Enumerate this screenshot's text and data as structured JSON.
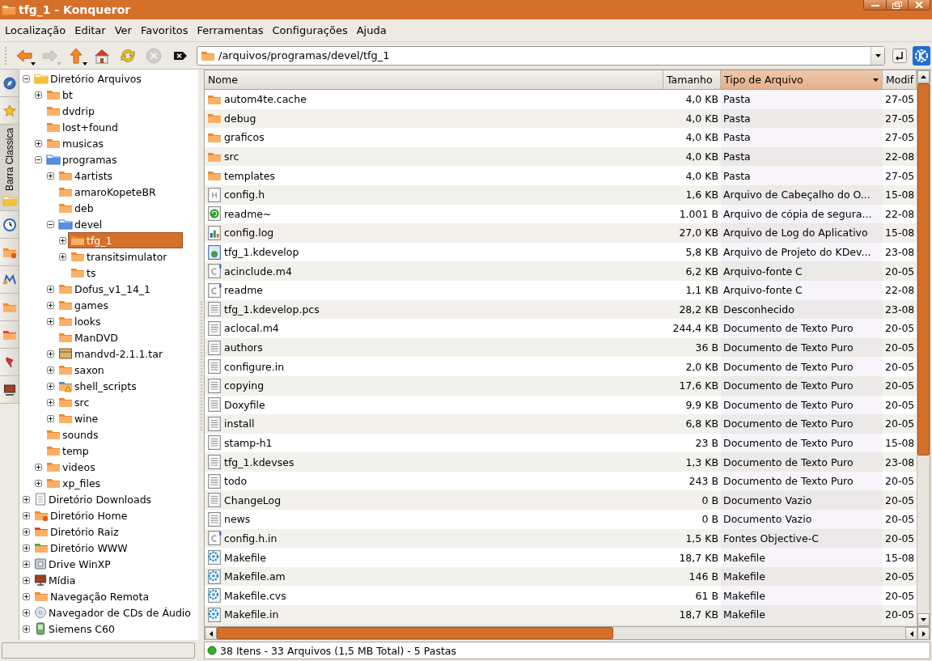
{
  "window": {
    "title": "tfg_1 - Konqueror"
  },
  "menu": [
    "Localização",
    "Editar",
    "Ver",
    "Favoritos",
    "Ferramentas",
    "Configurações",
    "Ajuda"
  ],
  "toolbar": [
    {
      "kind": "back",
      "disabled": false,
      "menu": true
    },
    {
      "kind": "forward",
      "disabled": true,
      "menu": true
    },
    {
      "kind": "up",
      "disabled": false,
      "menu": true
    },
    {
      "kind": "home",
      "disabled": false,
      "menu": false
    },
    {
      "kind": "reload",
      "disabled": false,
      "menu": false
    },
    {
      "kind": "stop",
      "disabled": true,
      "menu": false
    },
    {
      "kind": "clear",
      "disabled": false,
      "menu": false
    }
  ],
  "location": {
    "value": "/arquivos/programas/devel/tfg_1"
  },
  "sidebar_tabs": [
    {
      "kind": "navigation",
      "selected": false
    },
    {
      "kind": "bookmarks",
      "selected": false
    },
    {
      "kind": "folder",
      "selected": true,
      "label": "Barra Classica"
    },
    {
      "kind": "history",
      "selected": false
    },
    {
      "kind": "home",
      "selected": false
    },
    {
      "kind": "media",
      "selected": false
    },
    {
      "kind": "network",
      "selected": false
    },
    {
      "kind": "root",
      "selected": false
    },
    {
      "kind": "services",
      "selected": false
    },
    {
      "kind": "devices",
      "selected": false
    }
  ],
  "tree": [
    {
      "label": "Diretório Arquivos",
      "kind": "yellow-open",
      "expanded": true,
      "selected": false,
      "children": [
        {
          "label": "bt",
          "kind": "folder",
          "expanded": false,
          "selected": false
        },
        {
          "label": "dvdrip",
          "kind": "folder",
          "selected": false
        },
        {
          "label": "lost+found",
          "kind": "folder",
          "selected": false
        },
        {
          "label": "musicas",
          "kind": "folder",
          "expanded": false,
          "selected": false
        },
        {
          "label": "programas",
          "kind": "blue-open",
          "expanded": true,
          "selected": false,
          "children": [
            {
              "label": "4artists",
              "kind": "folder",
              "expanded": false,
              "selected": false
            },
            {
              "label": "amaroKopeteBR",
              "kind": "folder",
              "selected": false
            },
            {
              "label": "deb",
              "kind": "folder",
              "selected": false
            },
            {
              "label": "devel",
              "kind": "blue-open",
              "expanded": true,
              "selected": false,
              "children": [
                {
                  "label": "tfg_1",
                  "kind": "folder",
                  "expanded": false,
                  "selected": true
                },
                {
                  "label": "transitsimulator",
                  "kind": "folder",
                  "expanded": false,
                  "selected": false
                },
                {
                  "label": "ts",
                  "kind": "folder",
                  "selected": false
                }
              ]
            },
            {
              "label": "Dofus_v1_14_1",
              "kind": "folder",
              "expanded": false,
              "selected": false
            },
            {
              "label": "games",
              "kind": "folder",
              "expanded": false,
              "selected": false
            },
            {
              "label": "looks",
              "kind": "folder",
              "expanded": false,
              "selected": false
            },
            {
              "label": "ManDVD",
              "kind": "folder",
              "selected": false
            },
            {
              "label": "mandvd-2.1.1.tar",
              "kind": "archive",
              "expanded": false,
              "selected": false
            },
            {
              "label": "saxon",
              "kind": "folder",
              "expanded": false,
              "selected": false
            },
            {
              "label": "shell_scripts",
              "kind": "script-folder",
              "expanded": false,
              "selected": false
            },
            {
              "label": "src",
              "kind": "folder",
              "expanded": false,
              "selected": false
            },
            {
              "label": "wine",
              "kind": "folder",
              "expanded": false,
              "selected": false
            }
          ]
        },
        {
          "label": "sounds",
          "kind": "folder",
          "selected": false
        },
        {
          "label": "temp",
          "kind": "folder",
          "selected": false
        },
        {
          "label": "videos",
          "kind": "folder",
          "expanded": false,
          "selected": false
        },
        {
          "label": "xp_files",
          "kind": "folder",
          "expanded": false,
          "selected": false
        }
      ]
    },
    {
      "label": "Diretório Downloads",
      "kind": "document",
      "expanded": false,
      "selected": false
    },
    {
      "label": "Diretório Home",
      "kind": "home-folder",
      "expanded": false,
      "selected": false
    },
    {
      "label": "Diretório Raiz",
      "kind": "red-folder",
      "expanded": false,
      "selected": false
    },
    {
      "label": "Diretório WWW",
      "kind": "green-folder",
      "expanded": false,
      "selected": false
    },
    {
      "label": "Drive WinXP",
      "kind": "drive",
      "expanded": false,
      "selected": false
    },
    {
      "label": "Mídia",
      "kind": "monitor",
      "expanded": false,
      "selected": false
    },
    {
      "label": "Navegação Remota",
      "kind": "folder",
      "expanded": false,
      "selected": false
    },
    {
      "label": "Navegador de CDs de Áudio",
      "kind": "cd",
      "expanded": false,
      "selected": false
    },
    {
      "label": "Siemens C60",
      "kind": "phone",
      "expanded": false,
      "selected": false
    }
  ],
  "table": {
    "columns": [
      {
        "label": "Nome",
        "sorted": false
      },
      {
        "label": "Tamanho",
        "sorted": false
      },
      {
        "label": "Tipo de Arquivo",
        "sorted": true
      },
      {
        "label": "Modif",
        "sorted": false
      }
    ],
    "rows": [
      {
        "kind": "folder",
        "name": "autom4te.cache",
        "size": "4,0 KB",
        "type": "Pasta",
        "date": "27-05"
      },
      {
        "kind": "folder",
        "name": "debug",
        "size": "4,0 KB",
        "type": "Pasta",
        "date": "27-05"
      },
      {
        "kind": "folder",
        "name": "graficos",
        "size": "4,0 KB",
        "type": "Pasta",
        "date": "27-05"
      },
      {
        "kind": "folder",
        "name": "src",
        "size": "4,0 KB",
        "type": "Pasta",
        "date": "22-08"
      },
      {
        "kind": "folder",
        "name": "templates",
        "size": "4,0 KB",
        "type": "Pasta",
        "date": "27-05"
      },
      {
        "kind": "header",
        "name": "config.h",
        "size": "1,6 KB",
        "type": "Arquivo de Cabeçalho do O...",
        "date": "15-08"
      },
      {
        "kind": "backup",
        "name": "readme~",
        "size": "1.001 B",
        "type": "Arquivo de cópia de segura...",
        "date": "22-08"
      },
      {
        "kind": "log",
        "name": "config.log",
        "size": "27,0 KB",
        "type": "Arquivo de Log do Aplicativo",
        "date": "15-08"
      },
      {
        "kind": "project",
        "name": "tfg_1.kdevelop",
        "size": "5,8 KB",
        "type": "Arquivo de Projeto do KDev...",
        "date": "23-08"
      },
      {
        "kind": "csource",
        "name": "acinclude.m4",
        "size": "6,2 KB",
        "type": "Arquivo-fonte C",
        "date": "20-05"
      },
      {
        "kind": "csource",
        "name": "readme",
        "size": "1,1 KB",
        "type": "Arquivo-fonte C",
        "date": "22-08"
      },
      {
        "kind": "text",
        "name": "tfg_1.kdevelop.pcs",
        "size": "28,2 KB",
        "type": "Desconhecido",
        "date": "23-08"
      },
      {
        "kind": "text",
        "name": "aclocal.m4",
        "size": "244,4 KB",
        "type": "Documento de Texto Puro",
        "date": "20-05"
      },
      {
        "kind": "text",
        "name": "authors",
        "size": "36 B",
        "type": "Documento de Texto Puro",
        "date": "20-05"
      },
      {
        "kind": "text",
        "name": "configure.in",
        "size": "2,0 KB",
        "type": "Documento de Texto Puro",
        "date": "20-05"
      },
      {
        "kind": "text",
        "name": "copying",
        "size": "17,6 KB",
        "type": "Documento de Texto Puro",
        "date": "20-05"
      },
      {
        "kind": "text",
        "name": "Doxyfile",
        "size": "9,9 KB",
        "type": "Documento de Texto Puro",
        "date": "20-05"
      },
      {
        "kind": "text",
        "name": "install",
        "size": "6,8 KB",
        "type": "Documento de Texto Puro",
        "date": "20-05"
      },
      {
        "kind": "text",
        "name": "stamp-h1",
        "size": "23 B",
        "type": "Documento de Texto Puro",
        "date": "15-08"
      },
      {
        "kind": "text",
        "name": "tfg_1.kdevses",
        "size": "1,3 KB",
        "type": "Documento de Texto Puro",
        "date": "23-08"
      },
      {
        "kind": "text",
        "name": "todo",
        "size": "243 B",
        "type": "Documento de Texto Puro",
        "date": "20-05"
      },
      {
        "kind": "text",
        "name": "ChangeLog",
        "size": "0 B",
        "type": "Documento Vazio",
        "date": "20-05"
      },
      {
        "kind": "text",
        "name": "news",
        "size": "0 B",
        "type": "Documento Vazio",
        "date": "20-05"
      },
      {
        "kind": "csource",
        "name": "config.h.in",
        "size": "1,5 KB",
        "type": "Fontes Objective-C",
        "date": "20-05"
      },
      {
        "kind": "makefile",
        "name": "Makefile",
        "size": "18,7 KB",
        "type": "Makefile",
        "date": "15-08"
      },
      {
        "kind": "makefile",
        "name": "Makefile.am",
        "size": "146 B",
        "type": "Makefile",
        "date": "20-05"
      },
      {
        "kind": "makefile",
        "name": "Makefile.cvs",
        "size": "61 B",
        "type": "Makefile",
        "date": "20-05"
      },
      {
        "kind": "makefile",
        "name": "Makefile.in",
        "size": "18,7 KB",
        "type": "Makefile",
        "date": "20-05"
      }
    ]
  },
  "status_bar": {
    "text": "38 Itens - 33 Arquivos (1,5 MB Total) - 5 Pastas"
  }
}
